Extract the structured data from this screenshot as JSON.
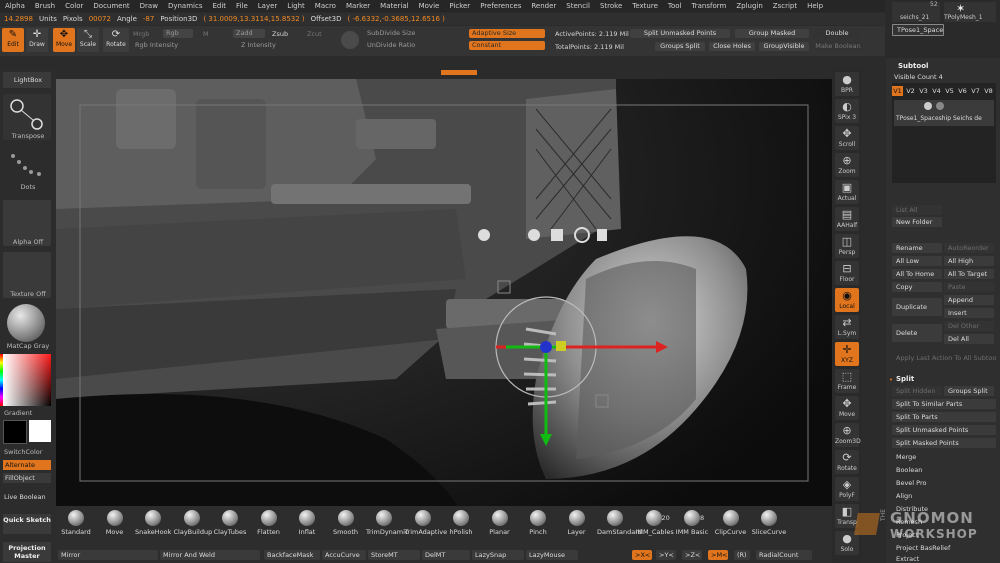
{
  "menu": [
    "Alpha",
    "Brush",
    "Color",
    "Document",
    "Draw",
    "Dynamics",
    "Edit",
    "File",
    "Layer",
    "Light",
    "Macro",
    "Marker",
    "Material",
    "Movie",
    "Picker",
    "Preferences",
    "Render",
    "Stencil",
    "Stroke",
    "Texture",
    "Tool",
    "Transform",
    "Zplugin",
    "Zscript",
    "Help"
  ],
  "info": {
    "units_value": "14.2898",
    "units_label": "Units",
    "pixols_label": "Pixols",
    "pixols_value": "00072",
    "angle_label": "Angle",
    "angle_value": "-87",
    "position3d_label": "Position3D",
    "position3d_value": "( 31.0009,13.3114,15.8532 )",
    "offset3d_label": "Offset3D",
    "offset3d_value": "( -6.6332,-0.3685,12.6516 )"
  },
  "toolbar": {
    "edit": "Edit",
    "draw": "Draw",
    "move": "Move",
    "scale": "Scale",
    "rotate": "Rotate",
    "mrgb": "Mrgb",
    "rgb": "Rgb",
    "m": "M",
    "rgb_intensity": "Rgb Intensity",
    "zadd": "Zadd",
    "zsub": "Zsub",
    "zcut": "Zcut",
    "z_intensity": "Z Intensity",
    "subdivide_size": "SubDivide Size",
    "undivide_ratio": "UnDivide Ratio",
    "adaptive_size": "Adaptive Size",
    "constant": "Constant",
    "active_points_label": "ActivePoints:",
    "active_points_value": "2.119 Mil",
    "total_points_label": "TotalPoints:",
    "total_points_value": "2.119 Mil",
    "split_unmasked": "Split Unmasked Points",
    "group_masked": "Group Masked",
    "double": "Double",
    "groups_split": "Groups Split",
    "close_holes": "Close Holes",
    "group_visible": "GroupVisible",
    "make_boolean": "Make Boolean"
  },
  "left": {
    "lightbox": "LightBox",
    "transpose": "Transpose",
    "dots": "Dots",
    "alpha_off": "Alpha Off",
    "texture_off": "Texture Off",
    "matcap_gray": "MatCap Gray",
    "gradient": "Gradient",
    "switch_color": "SwitchColor",
    "alternate": "Alternate",
    "fill_object": "FillObject",
    "live_boolean": "Live Boolean",
    "quick_sketch": "Quick Sketch",
    "projection_master": "Projection Master"
  },
  "right_shelf": [
    "BPR",
    "SPix 3",
    "Scroll",
    "Zoom",
    "Actual",
    "AAHalf",
    "Persp",
    "Floor",
    "Local",
    "L.Sym",
    "XYZ",
    "Frame",
    "Move",
    "Zoom3D",
    "Rotate",
    "PolyF",
    "Transp",
    "Solo"
  ],
  "panel": {
    "tool_names": [
      "seichs_21",
      "TPolyMesh_1"
    ],
    "tool_count": "52",
    "current_tool": "TPose1_Spaces",
    "subtool_header": "Subtool",
    "visible_count": "Visible Count 4",
    "versions": [
      "V1",
      "V2",
      "V3",
      "V4",
      "V5",
      "V6",
      "V7",
      "V8"
    ],
    "subtool_item": "TPose1_Spaceship Seichs de",
    "list_all": "List All",
    "new_folder": "New Folder",
    "rename": "Rename",
    "auto_reorder": "AutoReorder",
    "all_low": "All Low",
    "all_high": "All High",
    "all_to_home": "All To Home",
    "all_to_target": "All To Target",
    "copy": "Copy",
    "paste": "Paste",
    "duplicate": "Duplicate",
    "append": "Append",
    "insert": "Insert",
    "delete": "Delete",
    "del_other": "Del Other",
    "del_all": "Del All",
    "apply_last": "Apply Last Action To All Subtool",
    "split_header": "Split",
    "split_hidden": "Split Hidden",
    "groups_split": "Groups Split",
    "split_similar": "Split To Similar Parts",
    "split_parts": "Split To Parts",
    "split_unmasked": "Split Unmasked Points",
    "split_masked": "Split Masked Points",
    "merge": "Merge",
    "boolean": "Boolean",
    "bevel_pro": "Bevel Pro",
    "align": "Align",
    "distribute": "Distribute",
    "remesh": "Remesh",
    "project": "Project",
    "project_basrelief": "Project BasRelief",
    "extract": "Extract"
  },
  "brushes": [
    "Standard",
    "Move",
    "SnakeHook",
    "ClayBuildup",
    "ClayTubes",
    "Flatten",
    "Inflat",
    "Smooth",
    "TrimDynamic",
    "TrimAdaptive",
    "hPolish",
    "Planar",
    "Pinch",
    "Layer",
    "DamStandard",
    "IMM_Cables",
    "IMM Basic",
    "ClipCurve",
    "SliceCurve"
  ],
  "brush_counts": {
    "imm_cables": "20",
    "imm_basic": "8"
  },
  "bottom": {
    "mirror": "Mirror",
    "mirror_weld": "Mirror And Weld",
    "backface_mask": "BackfaceMask",
    "accu_curve": "AccuCurve",
    "store_mt": "StoreMT",
    "del_mt": "DelMT",
    "lazy_snap": "LazySnap",
    "lazy_mouse": "LazyMouse",
    "x_axis": ">X<",
    "y_axis": ">Y<",
    "z_axis": ">Z<",
    "m_axis": ">M<",
    "r_axis": "(R)",
    "radial_count": "RadialCount"
  },
  "watermark": {
    "the": "THE",
    "line1": "GNOMON",
    "line2": "WORKSHOP"
  },
  "colors": {
    "accent": "#e0751d",
    "panel": "#2a2a2a",
    "viewport": "#1b1b1b"
  }
}
